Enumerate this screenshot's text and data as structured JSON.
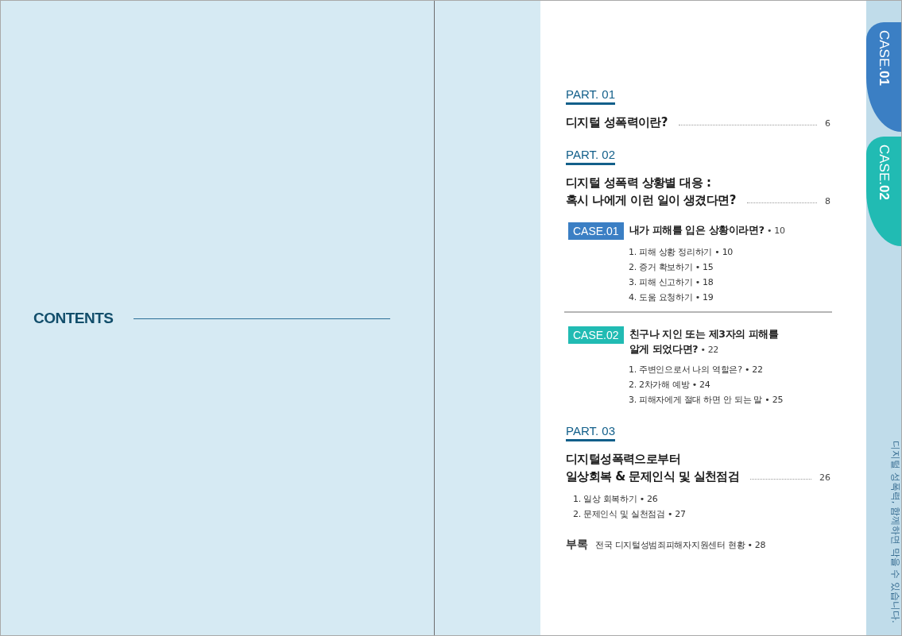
{
  "left_page": {
    "title": "CONTENTS"
  },
  "toc": [
    {
      "label": "PART. 01",
      "title_lines": [
        "디지털 성폭력이란?"
      ],
      "page": "6"
    },
    {
      "label": "PART. 02",
      "title_lines": [
        "디지털 성폭력 상황별 대응 :",
        "혹시 나에게 이런 일이 생겼다면?"
      ],
      "page": "8",
      "cases": [
        {
          "badge": "CASE.01",
          "color": "#3b7fc4",
          "title_lines": [
            "내가 피해를 입은 상황이라면?"
          ],
          "page": "• 10",
          "items": [
            "1. 피해 상황 정리하기 • 10",
            "2. 증거 확보하기 • 15",
            "3. 피해 신고하기 • 18",
            "4. 도움 요청하기 • 19"
          ]
        },
        {
          "badge": "CASE.02",
          "color": "#21bbb3",
          "title_lines": [
            "친구나 지인 또는 제3자의 피해를",
            "알게 되었다면?"
          ],
          "page": "• 22",
          "items": [
            "1. 주변인으로서 나의 역할은? • 22",
            "2. 2차가해 예방 • 24",
            "3. 피해자에게 절대 하면 안 되는 말 • 25"
          ]
        }
      ]
    },
    {
      "label": "PART. 03",
      "title_lines": [
        "디지털성폭력으로부터",
        "일상회복 & 문제인식 및 실천점검"
      ],
      "page": "26",
      "items": [
        "1. 일상 회복하기 • 26",
        "2. 문제인식 및 실천점검 • 27"
      ]
    }
  ],
  "appendix": {
    "label": "부록",
    "text": "전국 디지털성범죄피해자지원센터 현황 • 28"
  },
  "side_tabs": [
    {
      "label": "CASE.**01**",
      "color": "#3b7fc4"
    },
    {
      "label": "CASE.**02**",
      "color": "#21bbb3"
    }
  ],
  "side_caption": "디지털 성폭력, 함께하면 막을 수 있습니다."
}
